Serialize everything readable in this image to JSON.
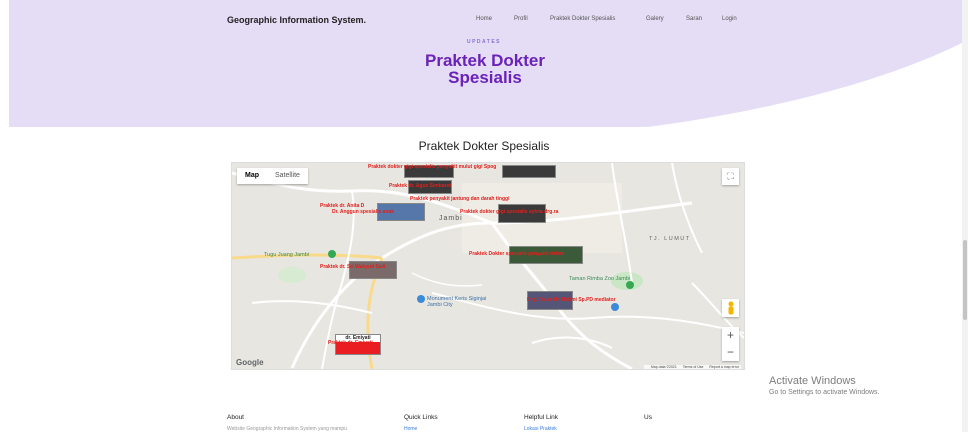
{
  "header": {
    "brand": "Geographic Information System.",
    "nav": [
      "Home",
      "Profil",
      "Praktek Dokter Spesialis",
      "Galery",
      "Saran",
      "Login"
    ]
  },
  "hero": {
    "eyebrow": "UPDATES",
    "title_line1": "Praktek Dokter",
    "title_line2": "Spesialis"
  },
  "section": {
    "title": "Praktek Dokter Spesialis"
  },
  "map": {
    "type_active": "Map",
    "type_inactive": "Satellite",
    "zoom_in": "+",
    "zoom_out": "−",
    "fullscreen": "⛶",
    "google": "Google",
    "attribution": [
      "Map data ©2021",
      "Terms of Use",
      "Report a map error"
    ],
    "place_labels": {
      "jambi": "Jambi",
      "tj_lumut": "TJ. LUMUT",
      "tugu": "Tugu Juang Jambi",
      "rimba": "Taman Rimba Zoo Jambi",
      "monument": "Monument Keris Siginjai Jambi City"
    },
    "markers": [
      "Praktek dokter gigi spesialis penyakit mulut gigi Spog",
      "Praktek dr. Agus Simbaret",
      "Praktek dr. Anita D",
      "Praktek penyakit jantung dan darah tinggi",
      "Dr. Anggun spesialis anak",
      "Praktek dokter gigi spesialis sylvia drg.ra",
      "Praktek Dokter spesialis penyakit dalam",
      "Praktek dr. Sri Wahyuti SpA",
      "Drg. Tessa Dr. Rahmi Sp.PD mediator",
      "Praktek dr. Emiyati",
      "dr. Emiyati"
    ]
  },
  "activate": {
    "line1": "Activate Windows",
    "line2": "Go to Settings to activate Windows."
  },
  "footer": {
    "about_head": "About",
    "about_text": "Website Geographic Information System yang mampu",
    "quick_head": "Quick Links",
    "quick_link": "Home",
    "helpful_head": "Helpful Link",
    "helpful_link": "Lokasi Praktek",
    "us_head": "Us"
  },
  "colors": {
    "hero_bg": "#e9e3f8",
    "title_purple": "#6a22b8",
    "marker_red": "#e0201c"
  }
}
